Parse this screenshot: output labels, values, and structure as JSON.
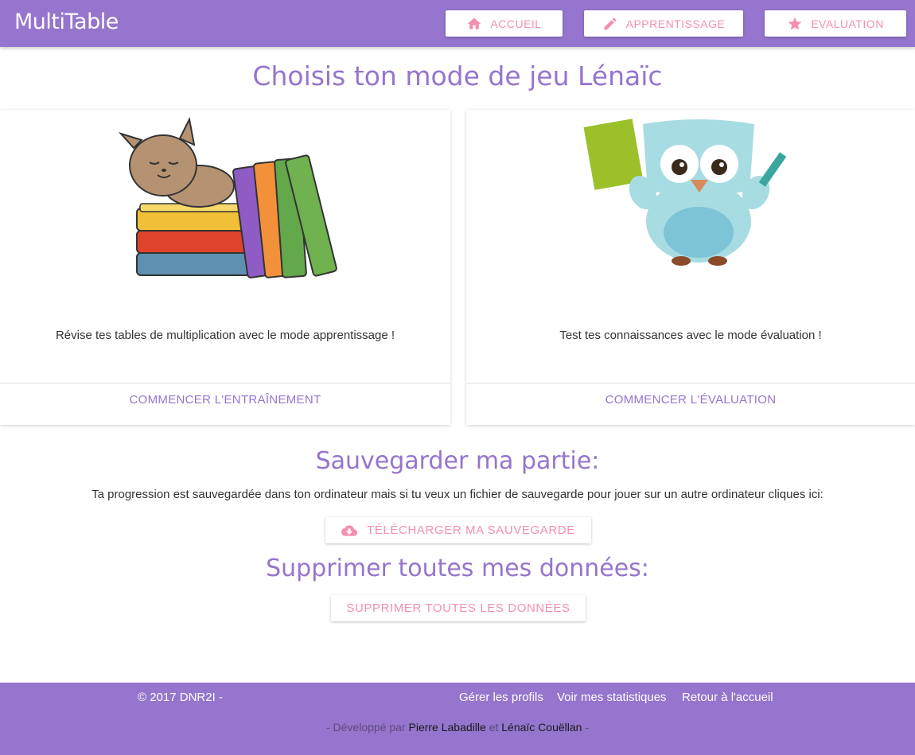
{
  "header": {
    "brand": "MultiTable",
    "nav": [
      {
        "label": "ACCUEIL",
        "icon": "home-icon"
      },
      {
        "label": "APPRENTISSAGE",
        "icon": "pencil-icon"
      },
      {
        "label": "EVALUATION",
        "icon": "star-icon"
      }
    ]
  },
  "main": {
    "title": "Choisis ton mode de jeu Lénaïc",
    "cards": [
      {
        "text": "Révise tes tables de multiplication avec le mode apprentissage !",
        "action": "COMMENCER L'ENTRAÎNEMENT",
        "image": "cat-on-books-illustration"
      },
      {
        "text": "Test tes connaissances avec le mode évaluation !",
        "action": "COMMENCER L'ÉVALUATION",
        "image": "owl-with-book-and-pencil-illustration"
      }
    ],
    "save": {
      "title": "Sauvegarder ma partie:",
      "text": "Ta progression est sauvegardée dans ton ordinateur mais si tu veux un fichier de sauvegarde pour jouer sur un autre ordinateur cliques ici:",
      "button": "TÉLÉCHARGER MA SAUVEGARDE",
      "icon": "cloud-download-icon"
    },
    "delete": {
      "title": "Supprimer toutes mes données:",
      "button": "SUPPRIMER TOUTES LES DONNÉES"
    }
  },
  "footer": {
    "copyright": "© 2017 DNR2I -",
    "links": [
      "Gérer les profils",
      "Voir mes statistiques",
      "Retour à l'accueil"
    ],
    "credits_prefix": "- Développé par",
    "author1": "Pierre Labadille",
    "credits_and": "et",
    "author2": "Lénaïc Couëllan",
    "credits_suffix": "-"
  },
  "colors": {
    "primary": "#9575cd",
    "accent": "#f48fb1"
  }
}
